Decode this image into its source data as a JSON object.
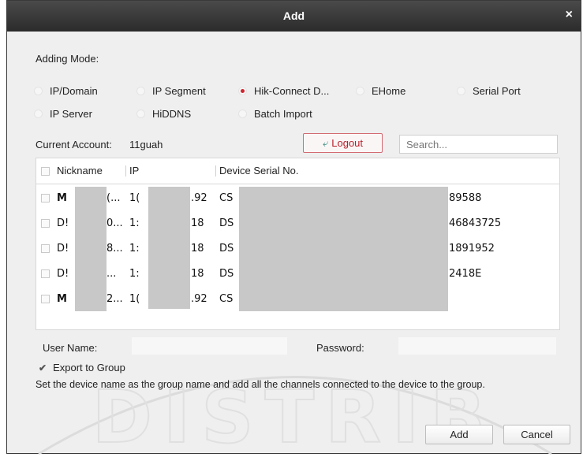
{
  "dialog": {
    "title": "Add",
    "close_glyph": "×"
  },
  "adding_mode": {
    "label": "Adding Mode:",
    "options": [
      {
        "label": "IP/Domain",
        "selected": false
      },
      {
        "label": "IP Segment",
        "selected": false
      },
      {
        "label": "Hik-Connect D...",
        "selected": true
      },
      {
        "label": "EHome",
        "selected": false
      },
      {
        "label": "Serial Port",
        "selected": false
      },
      {
        "label": "IP Server",
        "selected": false
      },
      {
        "label": "HiDDNS",
        "selected": false
      },
      {
        "label": "Batch Import",
        "selected": false
      }
    ]
  },
  "account": {
    "label": "Current Account:",
    "value": "11guah",
    "logout_label": "Logout",
    "search_placeholder": "Search..."
  },
  "table": {
    "columns": [
      "Nickname",
      "IP",
      "Device Serial No."
    ],
    "rows": [
      {
        "nickname": "M",
        "nickname_tail": "(...",
        "ip": "1(",
        "ip_tail": ".92",
        "serial": "CS",
        "serial_tail": "89588"
      },
      {
        "nickname": "D!",
        "nickname_tail": "0...",
        "ip": "1:",
        "ip_tail": "18",
        "serial": "DS",
        "serial_tail": "46843725"
      },
      {
        "nickname": "D!",
        "nickname_tail": "8...",
        "ip": "1:",
        "ip_tail": "18",
        "serial": "DS",
        "serial_tail": "1891952"
      },
      {
        "nickname": "D!",
        "nickname_tail": "...",
        "ip": "1:",
        "ip_tail": "18",
        "serial": "DS",
        "serial_tail": "2418E"
      },
      {
        "nickname": "M",
        "nickname_tail": "2...",
        "ip": "1(",
        "ip_tail": ".92",
        "serial": "CS",
        "serial_tail": ""
      }
    ]
  },
  "credentials": {
    "user_label": "User Name:",
    "user_value": "",
    "password_label": "Password:",
    "password_value": ""
  },
  "export": {
    "label": "Export to Group",
    "checked": true,
    "note": "Set the device name as the group name and add all the channels connected to the device to the group."
  },
  "footer": {
    "add_label": "Add",
    "cancel_label": "Cancel"
  },
  "watermark": {
    "text": "DISTRIB"
  },
  "colors": {
    "titlebar": "#2b2b2b",
    "radio_selected": "#d0242f",
    "logout_text": "#b61e2a",
    "redaction": "#c8c8c8"
  }
}
